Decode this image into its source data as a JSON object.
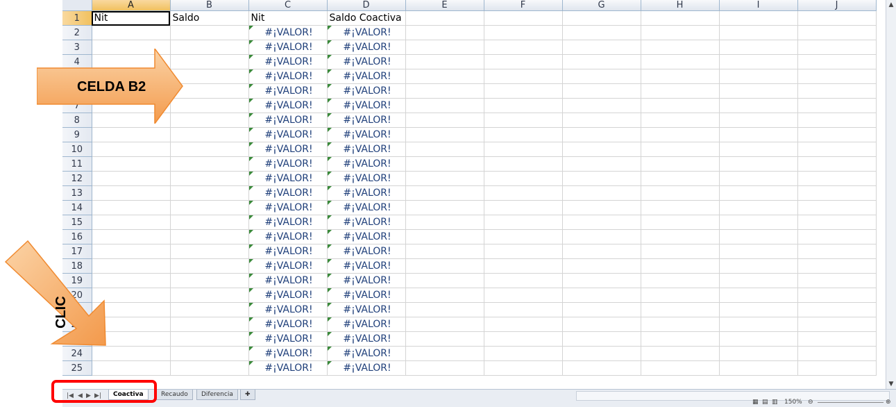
{
  "columns": [
    "A",
    "B",
    "C",
    "D",
    "E",
    "F",
    "G",
    "H",
    "I",
    "J"
  ],
  "selected_column": "A",
  "rows": [
    {
      "num": "1",
      "cells": [
        "Nit",
        "Saldo",
        "Nit",
        "Saldo Coactiva",
        "",
        "",
        "",
        "",
        "",
        ""
      ]
    },
    {
      "num": "2",
      "cells": [
        "",
        "",
        "#¡VALOR!",
        "#¡VALOR!",
        "",
        "",
        "",
        "",
        "",
        ""
      ]
    },
    {
      "num": "3",
      "cells": [
        "",
        "",
        "#¡VALOR!",
        "#¡VALOR!",
        "",
        "",
        "",
        "",
        "",
        ""
      ]
    },
    {
      "num": "4",
      "cells": [
        "",
        "",
        "#¡VALOR!",
        "#¡VALOR!",
        "",
        "",
        "",
        "",
        "",
        ""
      ]
    },
    {
      "num": "5",
      "cells": [
        "",
        "",
        "#¡VALOR!",
        "#¡VALOR!",
        "",
        "",
        "",
        "",
        "",
        ""
      ]
    },
    {
      "num": "6",
      "cells": [
        "",
        "",
        "#¡VALOR!",
        "#¡VALOR!",
        "",
        "",
        "",
        "",
        "",
        ""
      ]
    },
    {
      "num": "7",
      "cells": [
        "",
        "",
        "#¡VALOR!",
        "#¡VALOR!",
        "",
        "",
        "",
        "",
        "",
        ""
      ]
    },
    {
      "num": "8",
      "cells": [
        "",
        "",
        "#¡VALOR!",
        "#¡VALOR!",
        "",
        "",
        "",
        "",
        "",
        ""
      ]
    },
    {
      "num": "9",
      "cells": [
        "",
        "",
        "#¡VALOR!",
        "#¡VALOR!",
        "",
        "",
        "",
        "",
        "",
        ""
      ]
    },
    {
      "num": "10",
      "cells": [
        "",
        "",
        "#¡VALOR!",
        "#¡VALOR!",
        "",
        "",
        "",
        "",
        "",
        ""
      ]
    },
    {
      "num": "11",
      "cells": [
        "",
        "",
        "#¡VALOR!",
        "#¡VALOR!",
        "",
        "",
        "",
        "",
        "",
        ""
      ]
    },
    {
      "num": "12",
      "cells": [
        "",
        "",
        "#¡VALOR!",
        "#¡VALOR!",
        "",
        "",
        "",
        "",
        "",
        ""
      ]
    },
    {
      "num": "13",
      "cells": [
        "",
        "",
        "#¡VALOR!",
        "#¡VALOR!",
        "",
        "",
        "",
        "",
        "",
        ""
      ]
    },
    {
      "num": "14",
      "cells": [
        "",
        "",
        "#¡VALOR!",
        "#¡VALOR!",
        "",
        "",
        "",
        "",
        "",
        ""
      ]
    },
    {
      "num": "15",
      "cells": [
        "",
        "",
        "#¡VALOR!",
        "#¡VALOR!",
        "",
        "",
        "",
        "",
        "",
        ""
      ]
    },
    {
      "num": "16",
      "cells": [
        "",
        "",
        "#¡VALOR!",
        "#¡VALOR!",
        "",
        "",
        "",
        "",
        "",
        ""
      ]
    },
    {
      "num": "17",
      "cells": [
        "",
        "",
        "#¡VALOR!",
        "#¡VALOR!",
        "",
        "",
        "",
        "",
        "",
        ""
      ]
    },
    {
      "num": "18",
      "cells": [
        "",
        "",
        "#¡VALOR!",
        "#¡VALOR!",
        "",
        "",
        "",
        "",
        "",
        ""
      ]
    },
    {
      "num": "19",
      "cells": [
        "",
        "",
        "#¡VALOR!",
        "#¡VALOR!",
        "",
        "",
        "",
        "",
        "",
        ""
      ]
    },
    {
      "num": "20",
      "cells": [
        "",
        "",
        "#¡VALOR!",
        "#¡VALOR!",
        "",
        "",
        "",
        "",
        "",
        ""
      ]
    },
    {
      "num": "21",
      "cells": [
        "",
        "",
        "#¡VALOR!",
        "#¡VALOR!",
        "",
        "",
        "",
        "",
        "",
        ""
      ]
    },
    {
      "num": "22",
      "cells": [
        "",
        "",
        "#¡VALOR!",
        "#¡VALOR!",
        "",
        "",
        "",
        "",
        "",
        ""
      ]
    },
    {
      "num": "23",
      "cells": [
        "",
        "",
        "#¡VALOR!",
        "#¡VALOR!",
        "",
        "",
        "",
        "",
        "",
        ""
      ]
    },
    {
      "num": "24",
      "cells": [
        "",
        "",
        "#¡VALOR!",
        "#¡VALOR!",
        "",
        "",
        "",
        "",
        "",
        ""
      ]
    },
    {
      "num": "25",
      "cells": [
        "",
        "",
        "#¡VALOR!",
        "#¡VALOR!",
        "",
        "",
        "",
        "",
        "",
        ""
      ]
    }
  ],
  "sheet_tabs": [
    {
      "label": "Coactiva",
      "active": true
    },
    {
      "label": "Recaudo",
      "active": false
    },
    {
      "label": "Diferencia",
      "active": false
    }
  ],
  "status": {
    "zoom": "150%"
  },
  "annotations": {
    "arrow_label": "CELDA B2",
    "click_label": "CLIC",
    "arrow_color": "#f7b06a",
    "highlight_color": "#ff0000"
  }
}
